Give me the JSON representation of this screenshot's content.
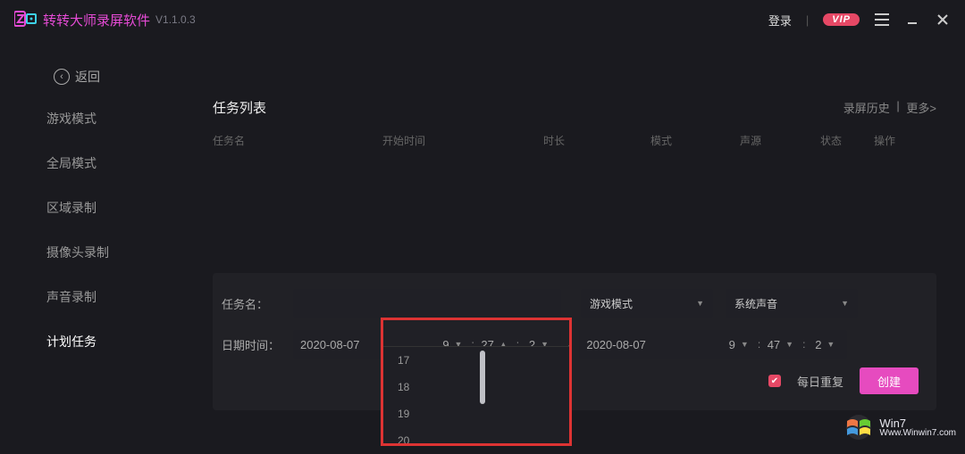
{
  "titlebar": {
    "app_name": "转转大师录屏软件",
    "version": "V1.1.0.3",
    "login": "登录",
    "vip": "VIP"
  },
  "back": {
    "label": "返回"
  },
  "sidebar": {
    "items": [
      {
        "label": "游戏模式"
      },
      {
        "label": "全局模式"
      },
      {
        "label": "区域录制"
      },
      {
        "label": "摄像头录制"
      },
      {
        "label": "声音录制"
      },
      {
        "label": "计划任务"
      }
    ],
    "activeIndex": 5
  },
  "list": {
    "title": "任务列表",
    "links": {
      "history": "录屏历史",
      "more": "更多>"
    },
    "columns": [
      "任务名",
      "开始时间",
      "时长",
      "模式",
      "声源",
      "状态",
      "操作"
    ]
  },
  "form": {
    "taskname_label": "任务名：",
    "taskname_value": "",
    "mode_select": "游戏模式",
    "audio_select": "系统声音",
    "datetime_label": "日期时间：",
    "start": {
      "date": "2020-08-07",
      "h": "9",
      "m": "27",
      "s": "2"
    },
    "end": {
      "date": "2020-08-07",
      "h": "9",
      "m": "47",
      "s": "2"
    },
    "repeat_checked": true,
    "repeat_label": "每日重复",
    "create_label": "创建"
  },
  "dropdown": {
    "options": [
      "17",
      "18",
      "19",
      "20"
    ]
  },
  "watermark": {
    "line1": "Win7",
    "line2": "Www.Winwin7.com"
  }
}
